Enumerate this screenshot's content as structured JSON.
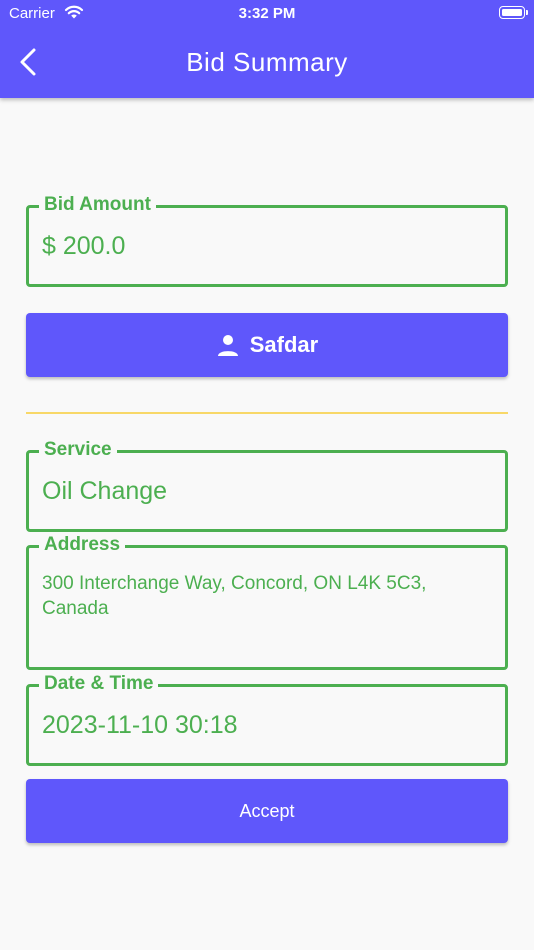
{
  "status_bar": {
    "carrier": "Carrier",
    "time": "3:32 PM"
  },
  "header": {
    "title": "Bid Summary",
    "back_icon": "chevron-left-icon"
  },
  "bid": {
    "label": "Bid Amount",
    "value": "$ 200.0"
  },
  "user_button": {
    "icon": "person-icon",
    "label": "Safdar"
  },
  "service": {
    "label": "Service",
    "value": "Oil Change"
  },
  "address": {
    "label": "Address",
    "value": "300 Interchange Way, Concord, ON L4K 5C3, Canada"
  },
  "datetime": {
    "label": "Date & Time",
    "value": "2023-11-10 30:18"
  },
  "accept_button": {
    "label": "Accept"
  },
  "colors": {
    "primary": "#5f57fb",
    "field_green": "#4caf50",
    "divider_yellow": "#f8d868",
    "background": "#f9f9f9"
  }
}
